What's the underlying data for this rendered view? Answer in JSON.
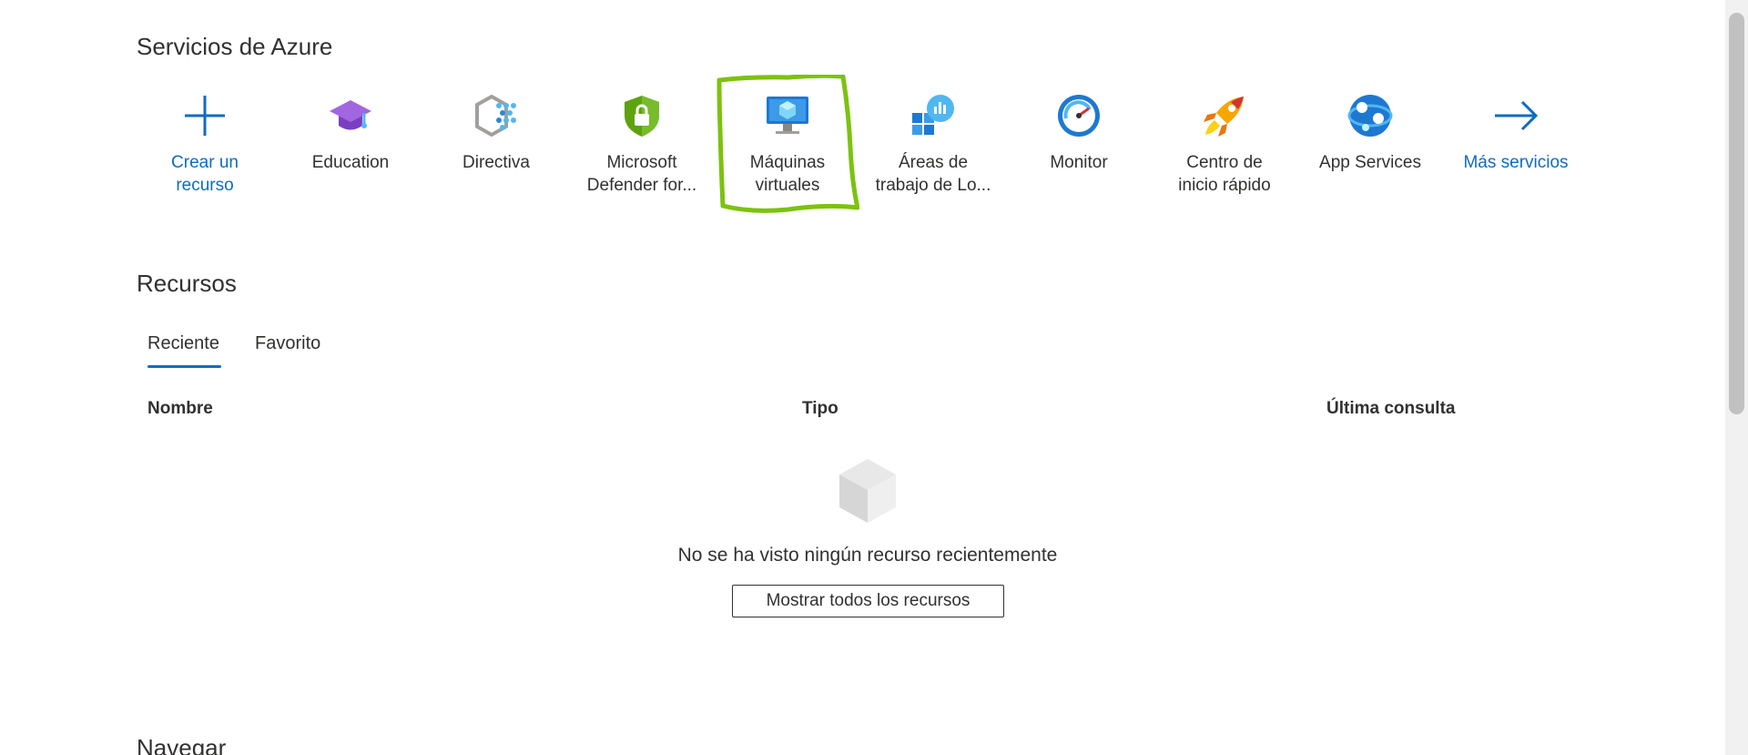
{
  "services": {
    "title": "Servicios de Azure",
    "items": [
      {
        "label_line1": "Crear un",
        "label_line2": "recurso",
        "icon": "plus-icon"
      },
      {
        "label_line1": "Education",
        "label_line2": "",
        "icon": "graduation-cap-icon"
      },
      {
        "label_line1": "Directiva",
        "label_line2": "",
        "icon": "policy-icon"
      },
      {
        "label_line1": "Microsoft",
        "label_line2": "Defender for...",
        "icon": "shield-lock-icon"
      },
      {
        "label_line1": "Máquinas",
        "label_line2": "virtuales",
        "icon": "virtual-machine-icon"
      },
      {
        "label_line1": "Áreas de",
        "label_line2": "trabajo de Lo...",
        "icon": "log-analytics-icon"
      },
      {
        "label_line1": "Monitor",
        "label_line2": "",
        "icon": "gauge-icon"
      },
      {
        "label_line1": "Centro de",
        "label_line2": "inicio rápido",
        "icon": "rocket-icon"
      },
      {
        "label_line1": "App Services",
        "label_line2": "",
        "icon": "globe-icon"
      },
      {
        "label_line1": "Más servicios",
        "label_line2": "",
        "icon": "arrow-right-icon"
      }
    ]
  },
  "resources": {
    "title": "Recursos",
    "tabs": [
      "Reciente",
      "Favorito"
    ],
    "columns": [
      "Nombre",
      "Tipo",
      "Última consulta"
    ],
    "empty_message": "No se ha visto ningún recurso recientemente",
    "show_all_label": "Mostrar todos los recursos"
  },
  "navigate": {
    "title": "Navegar"
  },
  "colors": {
    "accent": "#0f6cbd",
    "highlight": "#7cc20e",
    "text": "#323130"
  }
}
